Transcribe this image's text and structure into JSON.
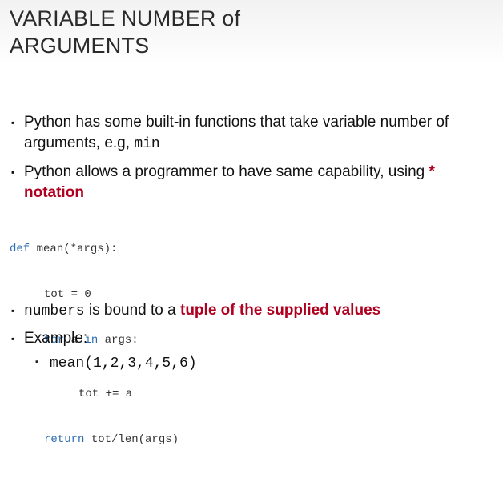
{
  "title": {
    "line1": "VARIABLE NUMBER of",
    "line2": "ARGUMENTS"
  },
  "bullets": {
    "b1_text": "Python has some built-in functions that take variable number of arguments, e.g,",
    "b1_code": "min",
    "b2_text": "Python allows a programmer to have same capability, using",
    "b2_emph": "* notation",
    "b3_code": "numbers",
    "b3_text": "is bound to a",
    "b3_emph": "tuple of the supplied values",
    "b4_text": "Example:",
    "b4_sub": "mean(1,2,3,4,5,6)",
    "marker": "▪"
  },
  "code": {
    "l1_kw": "def",
    "l1_rest": " mean(*args):",
    "l2": "tot = 0",
    "l3_kw1": "for",
    "l3_mid": " a ",
    "l3_kw2": "in",
    "l3_rest": " args:",
    "l4": "tot += a",
    "l5_kw": "return",
    "l5_rest": " tot/len(args)"
  }
}
